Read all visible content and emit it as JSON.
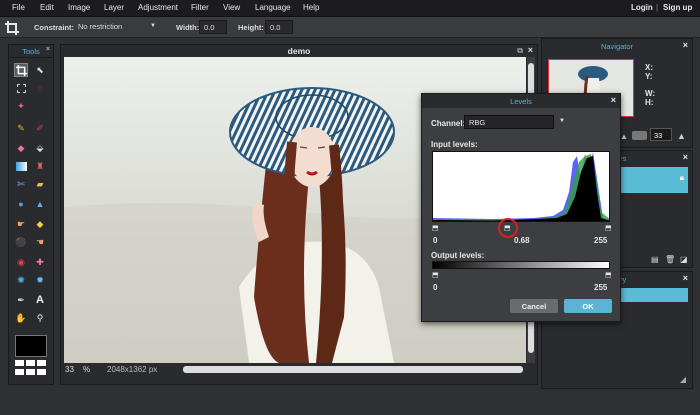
{
  "menu": {
    "items": [
      "File",
      "Edit",
      "Image",
      "Layer",
      "Adjustment",
      "Filter",
      "View",
      "Language",
      "Help"
    ],
    "login": "Login",
    "sep": "|",
    "signup": "Sign up"
  },
  "options": {
    "constraint_label": "Constraint:",
    "constraint_value": "No restriction",
    "width_label": "Width:",
    "width_value": "0.0",
    "height_label": "Height:",
    "height_value": "0.0"
  },
  "tools": {
    "title": "Tools"
  },
  "canvas": {
    "title": "demo",
    "zoom": "33",
    "zoom_unit": "%",
    "dimensions": "2048x1362 px"
  },
  "navigator": {
    "title": "Navigator",
    "x_label": "X:",
    "y_label": "Y:",
    "w_label": "W:",
    "h_label": "H:",
    "zoom": "33"
  },
  "layers": {
    "title_fragment": "rs"
  },
  "history": {
    "title_fragment": "ry"
  },
  "levels": {
    "title": "Levels",
    "channel_label": "Channel:",
    "channel_value": "RBG",
    "input_label": "Input levels:",
    "input_black": "0",
    "input_mid": "0.68",
    "input_white": "255",
    "output_label": "Output levels:",
    "output_black": "0",
    "output_white": "255",
    "cancel": "Cancel",
    "ok": "OK"
  },
  "colors": {
    "accent": "#4fb8d8",
    "ok_button": "#5ab4d6",
    "highlight_circle": "#d8201c"
  }
}
